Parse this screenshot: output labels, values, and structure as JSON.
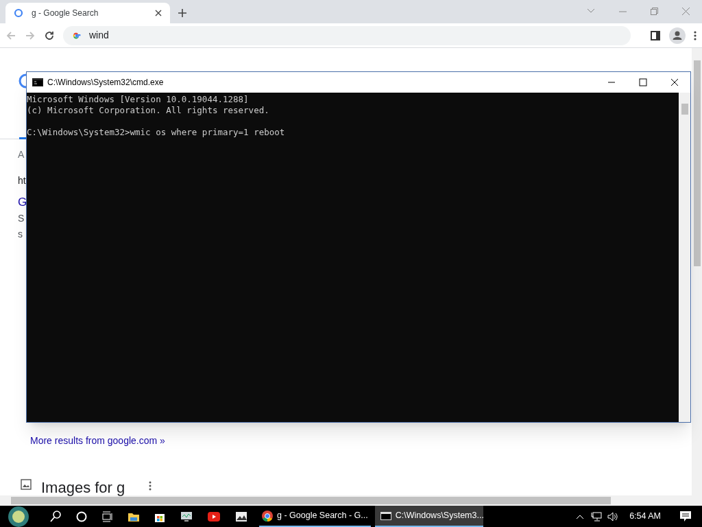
{
  "browser": {
    "tabs": [
      {
        "title": "g - Google Search",
        "selected": true
      }
    ],
    "address": "wind"
  },
  "page": {
    "fragments": [
      "A",
      "ht",
      "G",
      "S",
      "s"
    ],
    "more_results": "More results from google.com »",
    "images_heading": "Images for g"
  },
  "console": {
    "title": "C:\\Windows\\System32\\cmd.exe",
    "blocks": [
      [
        "Microsoft Windows [Version 10.0.19044.1288]",
        "(c) Microsoft Corporation. All rights reserved."
      ],
      [
        "C:\\Windows\\System32>wmic os where primary=1 reboot"
      ]
    ]
  },
  "taskbar": {
    "windows": [
      {
        "kind": "chrome",
        "title": "g - Google Search - G...",
        "selected": false
      },
      {
        "kind": "cmd",
        "title": "C:\\Windows\\System3...",
        "selected": true
      }
    ],
    "time": "6:54 AM"
  }
}
